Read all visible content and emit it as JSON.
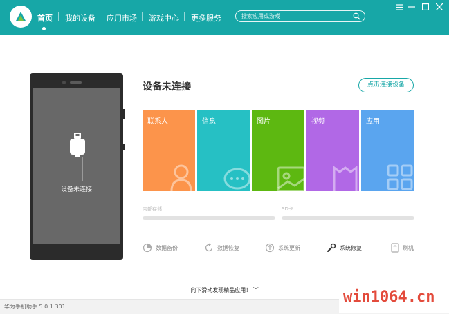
{
  "nav": {
    "items": [
      "首页",
      "我的设备",
      "应用市场",
      "游戏中心",
      "更多服务"
    ],
    "active_index": 0
  },
  "search": {
    "placeholder": "搜索应用或游戏"
  },
  "window_controls": [
    "menu-icon",
    "minimize-icon",
    "maximize-icon",
    "close-icon"
  ],
  "device": {
    "screen_label": "设备未连接",
    "title": "设备未连接",
    "connect_button": "点击连接设备"
  },
  "tiles": [
    {
      "label": "联系人",
      "icon": "contact-icon",
      "color": "#fc944b"
    },
    {
      "label": "信息",
      "icon": "message-icon",
      "color": "#26c0c4"
    },
    {
      "label": "图片",
      "icon": "picture-icon",
      "color": "#5db811"
    },
    {
      "label": "视频",
      "icon": "video-icon",
      "color": "#b168e6"
    },
    {
      "label": "应用",
      "icon": "apps-icon",
      "color": "#5aa5ef"
    }
  ],
  "storage": {
    "internal_label": "内部存储",
    "sd_label": "SD卡"
  },
  "tools": [
    {
      "label": "数据备份",
      "icon": "backup-icon"
    },
    {
      "label": "数据恢复",
      "icon": "restore-icon"
    },
    {
      "label": "系统更新",
      "icon": "update-icon"
    },
    {
      "label": "系统修复",
      "icon": "wrench-icon"
    },
    {
      "label": "刷机",
      "icon": "flash-icon"
    }
  ],
  "scroll_hint": "向下滑动发现精品应用！",
  "status": {
    "version": "华为手机助手 5.0.1.301"
  },
  "watermark": "win1064.cn",
  "colors": {
    "accent": "#17a7a7"
  }
}
